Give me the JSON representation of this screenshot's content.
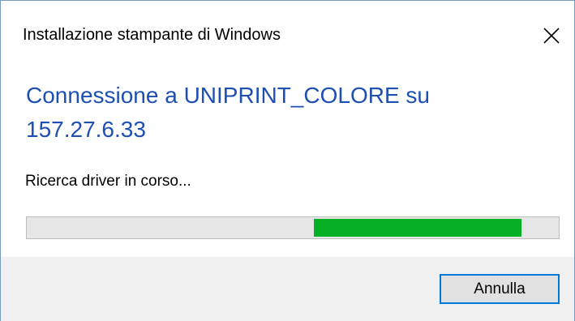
{
  "window": {
    "title": "Installazione stampante di Windows",
    "top_fragment": "Installa... p..."
  },
  "heading": {
    "line1": "Connessione a UNIPRINT_COLORE su",
    "line2": "157.27.6.33"
  },
  "status_text": "Ricerca driver in corso...",
  "progress": {
    "state": "indeterminate",
    "fill_start_fraction": 0.54,
    "fill_end_fraction": 0.93,
    "color": "#06b025"
  },
  "buttons": {
    "cancel_label": "Annulla"
  },
  "icons": {
    "close": "close-icon"
  },
  "colors": {
    "heading": "#1e4fb3",
    "accent_border": "#0078d7",
    "footer_bg": "#f0f0f0"
  }
}
